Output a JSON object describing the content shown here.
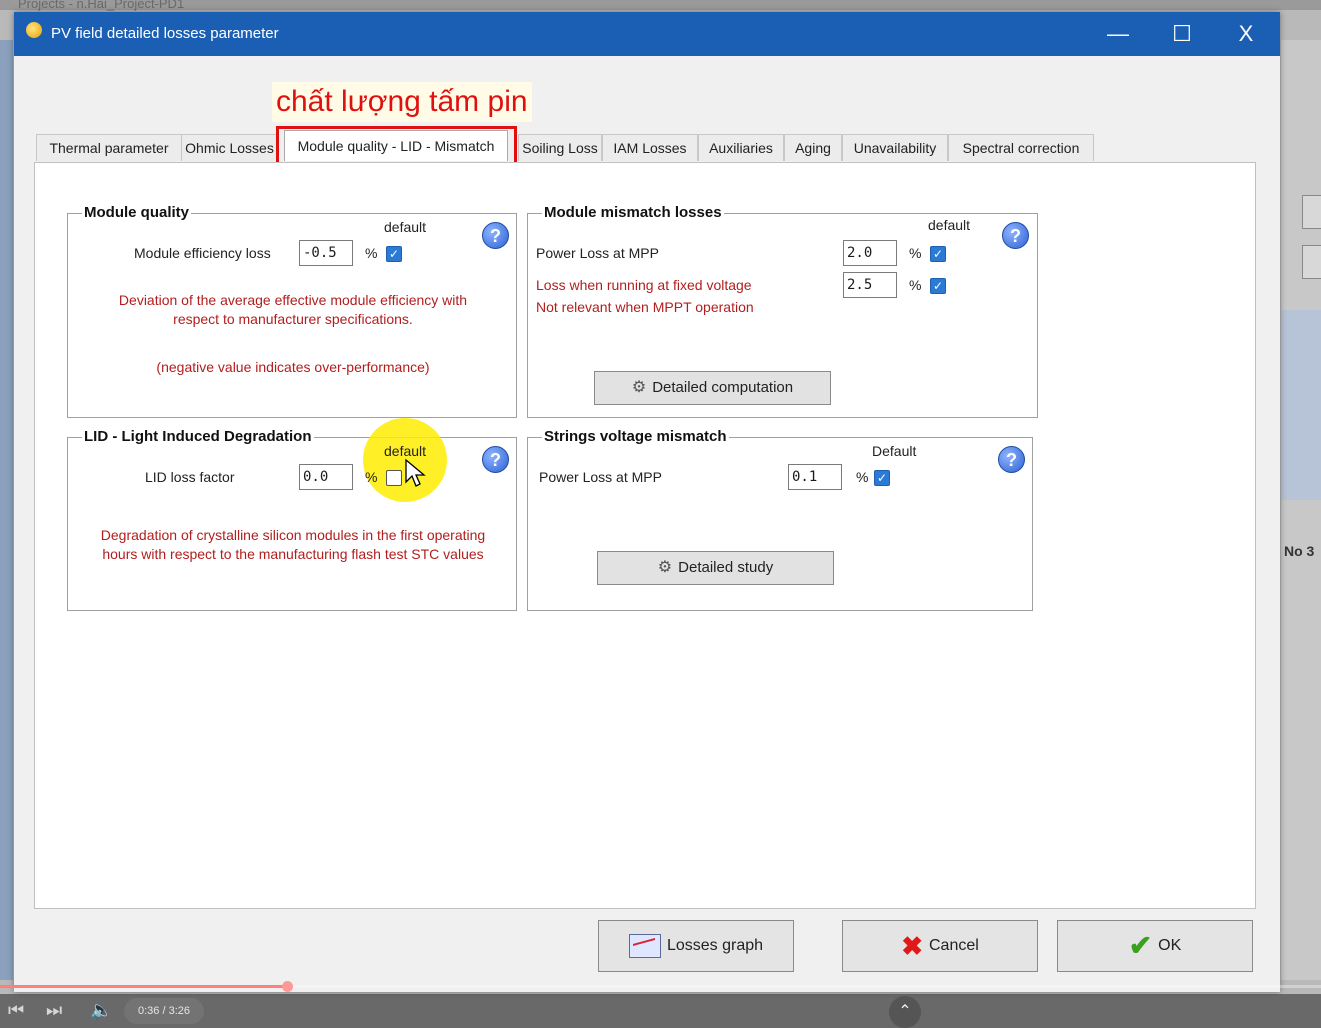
{
  "background": {
    "partial_title": "Projects - n.Hai_Project-PD1",
    "right_label": "No 3"
  },
  "window": {
    "title": "PV field detailed losses parameter",
    "minimize": "—",
    "maximize": "☐",
    "close": "X"
  },
  "annotation": "chất lượng tấm pin",
  "tabs": [
    {
      "label": "Thermal parameter"
    },
    {
      "label": "Ohmic Losses"
    },
    {
      "label": "Module quality - LID - Mismatch"
    },
    {
      "label": "Soiling Loss"
    },
    {
      "label": "IAM Losses"
    },
    {
      "label": "Auxiliaries"
    },
    {
      "label": "Aging"
    },
    {
      "label": "Unavailability"
    },
    {
      "label": "Spectral correction"
    }
  ],
  "module_quality": {
    "title": "Module quality",
    "default_label": "default",
    "efficiency_label": "Module efficiency loss",
    "efficiency_value": "-0.5",
    "unit": "%",
    "default_checked": true,
    "note1_line1": "Deviation of the average effective module efficiency with",
    "note1_line2": "respect to manufacturer specifications.",
    "note2": "(negative value indicates over-performance)"
  },
  "module_mismatch": {
    "title": "Module mismatch losses",
    "default_label": "default",
    "power_loss_label": "Power Loss at MPP",
    "power_loss_value": "2.0",
    "fixed_voltage_label": "Loss when running at fixed voltage",
    "fixed_voltage_value": "2.5",
    "not_relevant_label": "Not relevant when MPPT operation",
    "unit": "%",
    "button": "Detailed computation"
  },
  "lid": {
    "title": "LID - Light Induced Degradation",
    "default_label": "default",
    "factor_label": "LID loss factor",
    "factor_value": "0.0",
    "unit": "%",
    "default_checked": false,
    "note_line1": "Degradation of crystalline silicon modules in the first operating",
    "note_line2": "hours with respect to the manufacturing flash test STC values"
  },
  "strings_mismatch": {
    "title": "Strings voltage mismatch",
    "default_label": "Default",
    "power_loss_label": "Power Loss at MPP",
    "power_loss_value": "0.1",
    "unit": "%",
    "button": "Detailed study"
  },
  "footer": {
    "losses_graph": "Losses graph",
    "cancel": "Cancel",
    "ok": "OK"
  },
  "player": {
    "time": "0:36 / 3:26",
    "progress_fraction": 0.088
  }
}
